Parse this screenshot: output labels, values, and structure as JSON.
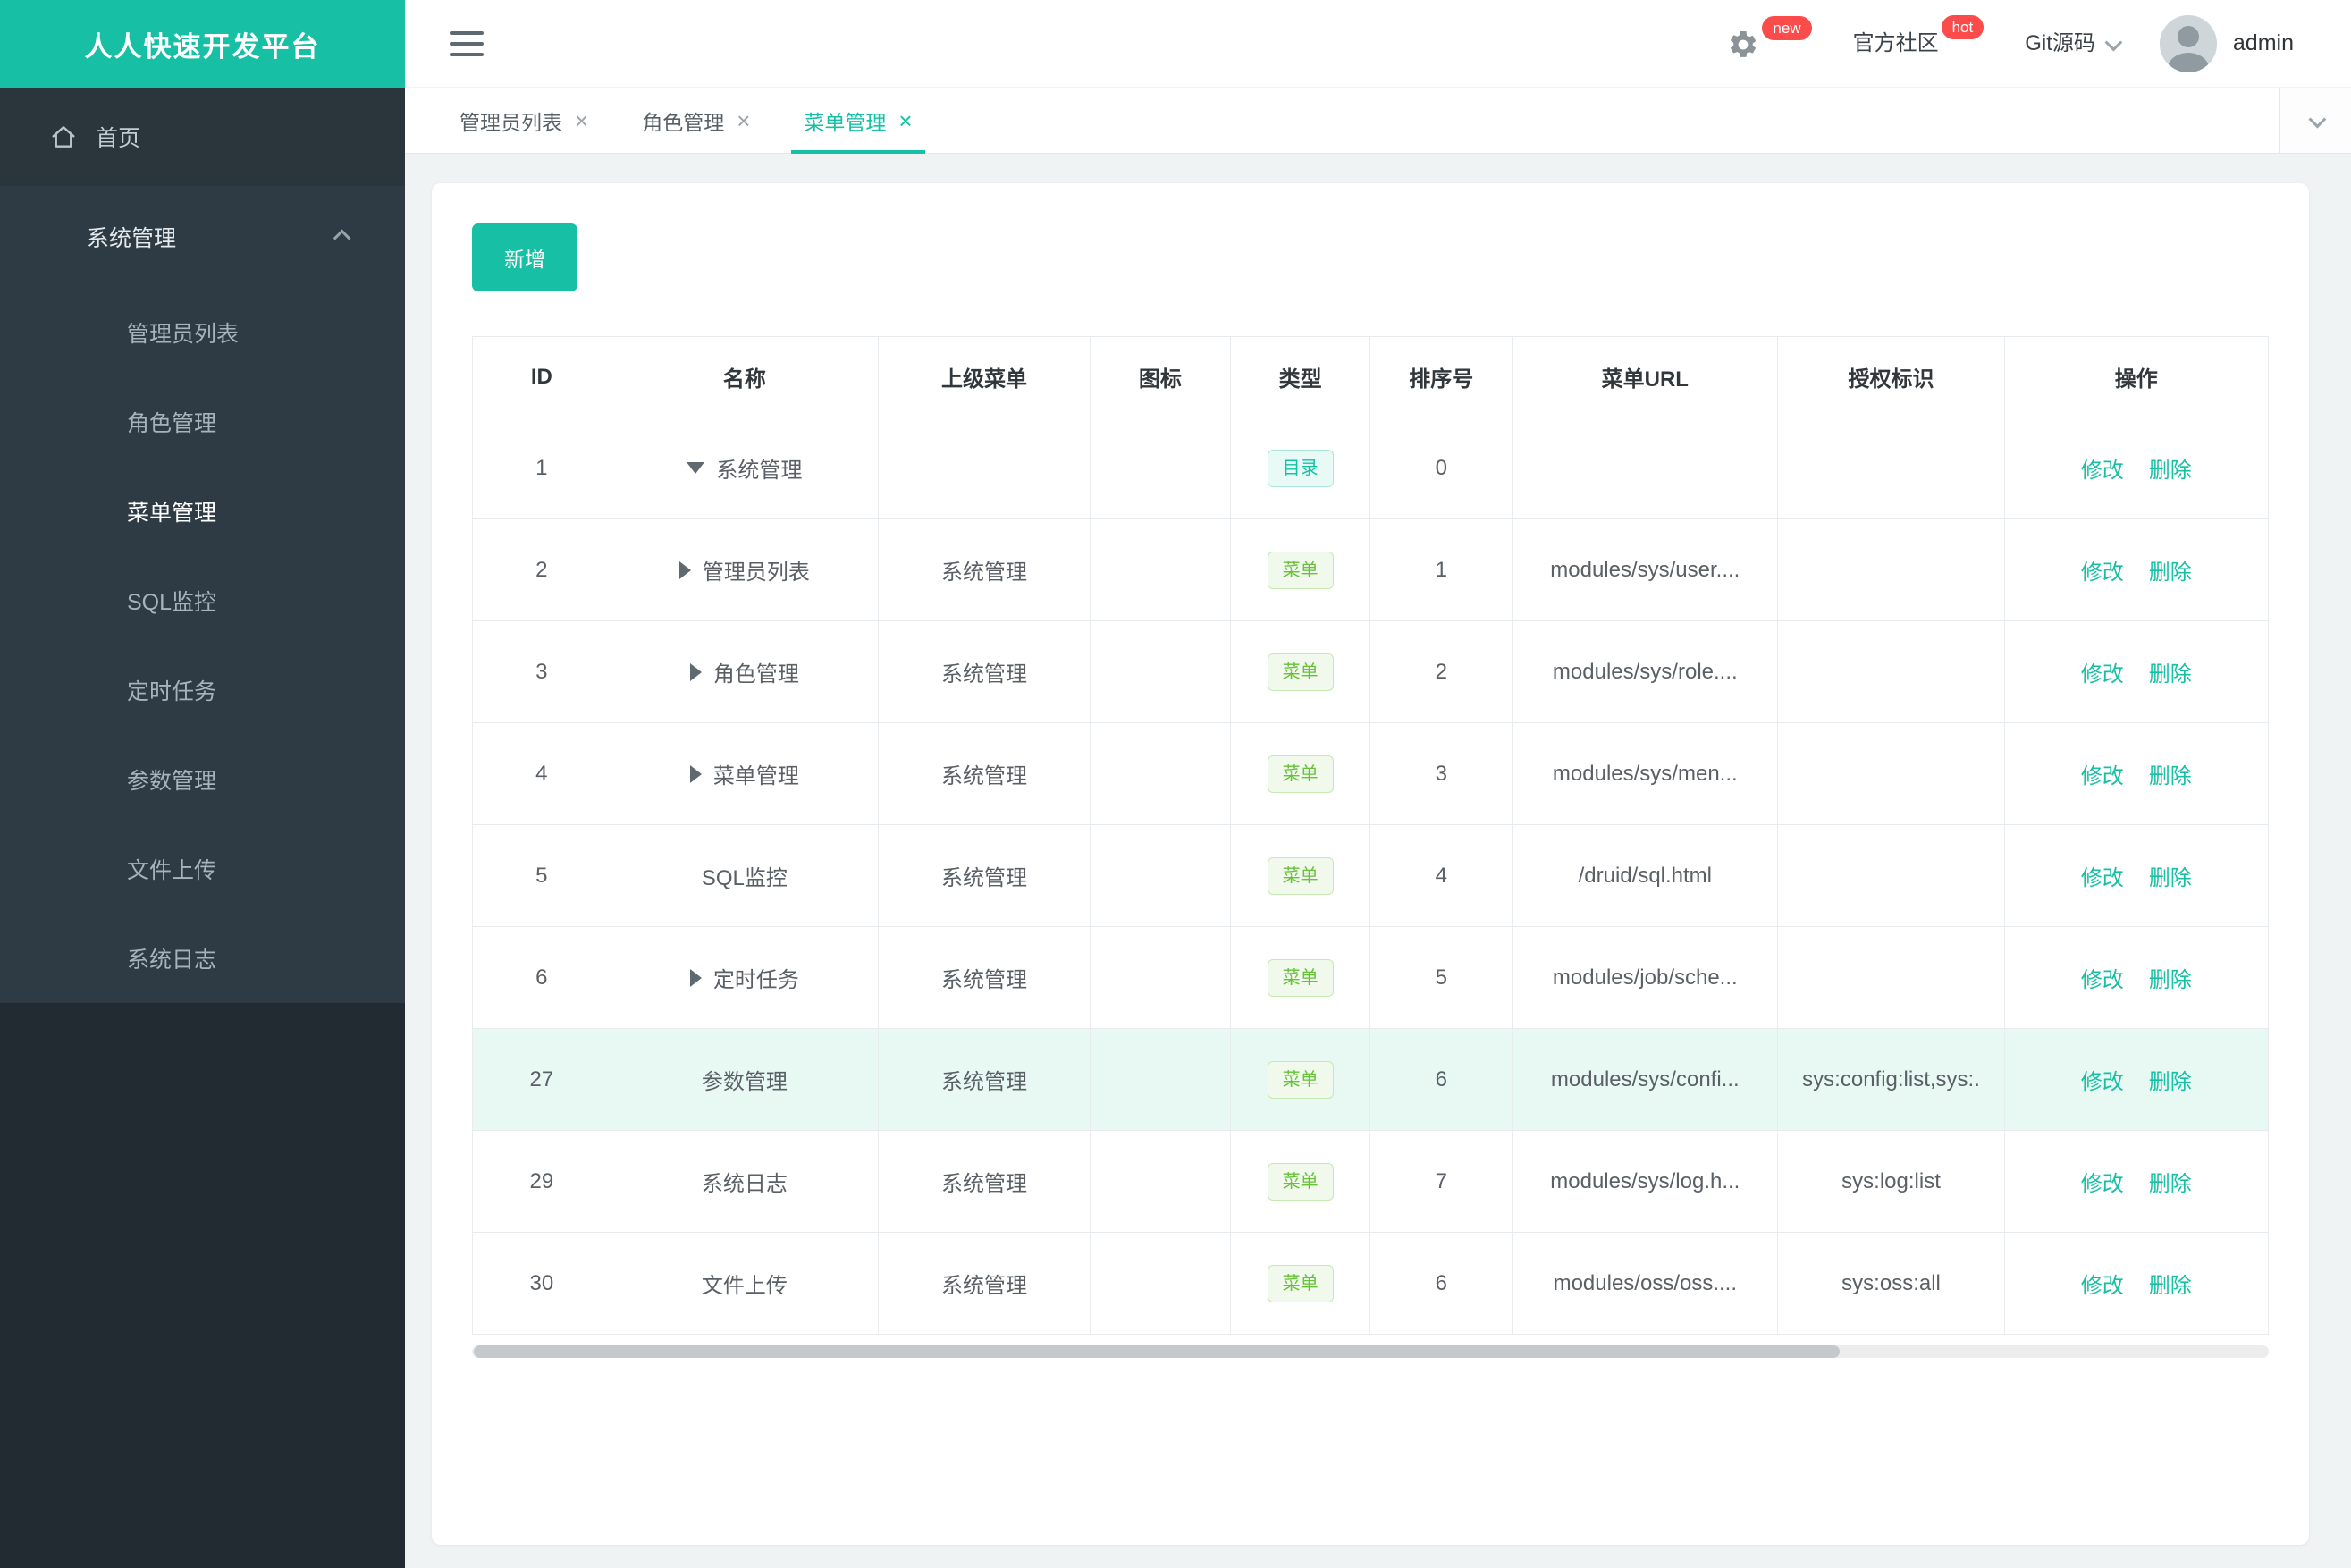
{
  "app": {
    "logo_title": "人人快速开发平台"
  },
  "topbar": {
    "settings_badge": "new",
    "community_label": "官方社区",
    "community_badge": "hot",
    "git_label": "Git源码",
    "username": "admin"
  },
  "sidebar": {
    "home_label": "首页",
    "group": {
      "label": "系统管理",
      "active": "菜单管理",
      "items": [
        "管理员列表",
        "角色管理",
        "菜单管理",
        "SQL监控",
        "定时任务",
        "参数管理",
        "文件上传",
        "系统日志"
      ]
    }
  },
  "tabs": [
    {
      "label": "管理员列表",
      "active": false
    },
    {
      "label": "角色管理",
      "active": false
    },
    {
      "label": "菜单管理",
      "active": true
    }
  ],
  "toolbar": {
    "add_label": "新增"
  },
  "table": {
    "columns": [
      "ID",
      "名称",
      "上级菜单",
      "图标",
      "类型",
      "排序号",
      "菜单URL",
      "授权标识",
      "操作"
    ],
    "actions": {
      "edit": "修改",
      "delete": "删除"
    },
    "rows": [
      {
        "id": "1",
        "arrow": "expanded",
        "name": "系统管理",
        "parent": "",
        "icon": "",
        "type": "目录",
        "type_kind": "dir",
        "order": "0",
        "url": "",
        "perms": "",
        "highlight": false
      },
      {
        "id": "2",
        "arrow": "collapsed",
        "name": "管理员列表",
        "parent": "系统管理",
        "icon": "",
        "type": "菜单",
        "type_kind": "menu",
        "order": "1",
        "url": "modules/sys/user....",
        "perms": "",
        "highlight": false
      },
      {
        "id": "3",
        "arrow": "collapsed",
        "name": "角色管理",
        "parent": "系统管理",
        "icon": "",
        "type": "菜单",
        "type_kind": "menu",
        "order": "2",
        "url": "modules/sys/role....",
        "perms": "",
        "highlight": false
      },
      {
        "id": "4",
        "arrow": "collapsed",
        "name": "菜单管理",
        "parent": "系统管理",
        "icon": "",
        "type": "菜单",
        "type_kind": "menu",
        "order": "3",
        "url": "modules/sys/men...",
        "perms": "",
        "highlight": false
      },
      {
        "id": "5",
        "arrow": "none",
        "name": "SQL监控",
        "parent": "系统管理",
        "icon": "",
        "type": "菜单",
        "type_kind": "menu",
        "order": "4",
        "url": "/druid/sql.html",
        "perms": "",
        "highlight": false
      },
      {
        "id": "6",
        "arrow": "collapsed",
        "name": "定时任务",
        "parent": "系统管理",
        "icon": "",
        "type": "菜单",
        "type_kind": "menu",
        "order": "5",
        "url": "modules/job/sche...",
        "perms": "",
        "highlight": false
      },
      {
        "id": "27",
        "arrow": "none",
        "name": "参数管理",
        "parent": "系统管理",
        "icon": "",
        "type": "菜单",
        "type_kind": "menu",
        "order": "6",
        "url": "modules/sys/confi...",
        "perms": "sys:config:list,sys:.",
        "highlight": true
      },
      {
        "id": "29",
        "arrow": "none",
        "name": "系统日志",
        "parent": "系统管理",
        "icon": "",
        "type": "菜单",
        "type_kind": "menu",
        "order": "7",
        "url": "modules/sys/log.h...",
        "perms": "sys:log:list",
        "highlight": false
      },
      {
        "id": "30",
        "arrow": "none",
        "name": "文件上传",
        "parent": "系统管理",
        "icon": "",
        "type": "菜单",
        "type_kind": "menu",
        "order": "6",
        "url": "modules/oss/oss....",
        "perms": "sys:oss:all",
        "highlight": false
      }
    ]
  },
  "colors": {
    "brand": "#17c0a5",
    "tag_dir": "#13c2a3",
    "tag_menu": "#67c23a",
    "badge_red": "#fb4b4b",
    "sidebar_bg": "#2b353c"
  }
}
